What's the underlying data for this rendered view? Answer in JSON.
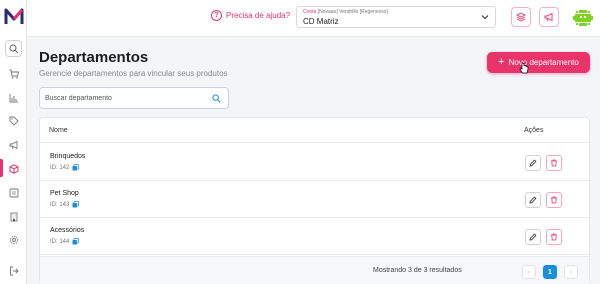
{
  "header": {
    "help_label": "Precisa de ajuda?",
    "account": {
      "line1_prefix": "Conta",
      "line1_rest": "[Novaao] Vendrillo [Regenesso]",
      "selected": "CD Matriz"
    }
  },
  "page": {
    "title": "Departamentos",
    "subtitle": "Gerencie departamentos para vincular seus produtos",
    "new_button_label": "Novo departamento"
  },
  "search": {
    "placeholder": "Buscar departamento"
  },
  "table": {
    "col_name": "Nome",
    "col_actions": "Ações",
    "rows": [
      {
        "name": "Brinquedos",
        "id": "ID: 142"
      },
      {
        "name": "Pet Shop",
        "id": "ID: 143"
      },
      {
        "name": "Acessórios",
        "id": "ID: 144"
      }
    ]
  },
  "pagination": {
    "info": "Mostrando 3 de 3 resultados",
    "prev": "‹",
    "current": "1",
    "next": "›"
  },
  "colors": {
    "accent": "#e8336b",
    "primary_blue": "#1a8fd8"
  },
  "icons": {
    "sidebar": [
      "search-icon",
      "cart-icon",
      "chart-icon",
      "tag-icon",
      "megaphone-icon",
      "box-icon",
      "list-icon",
      "building-icon",
      "gear-icon",
      "logout-icon"
    ]
  }
}
